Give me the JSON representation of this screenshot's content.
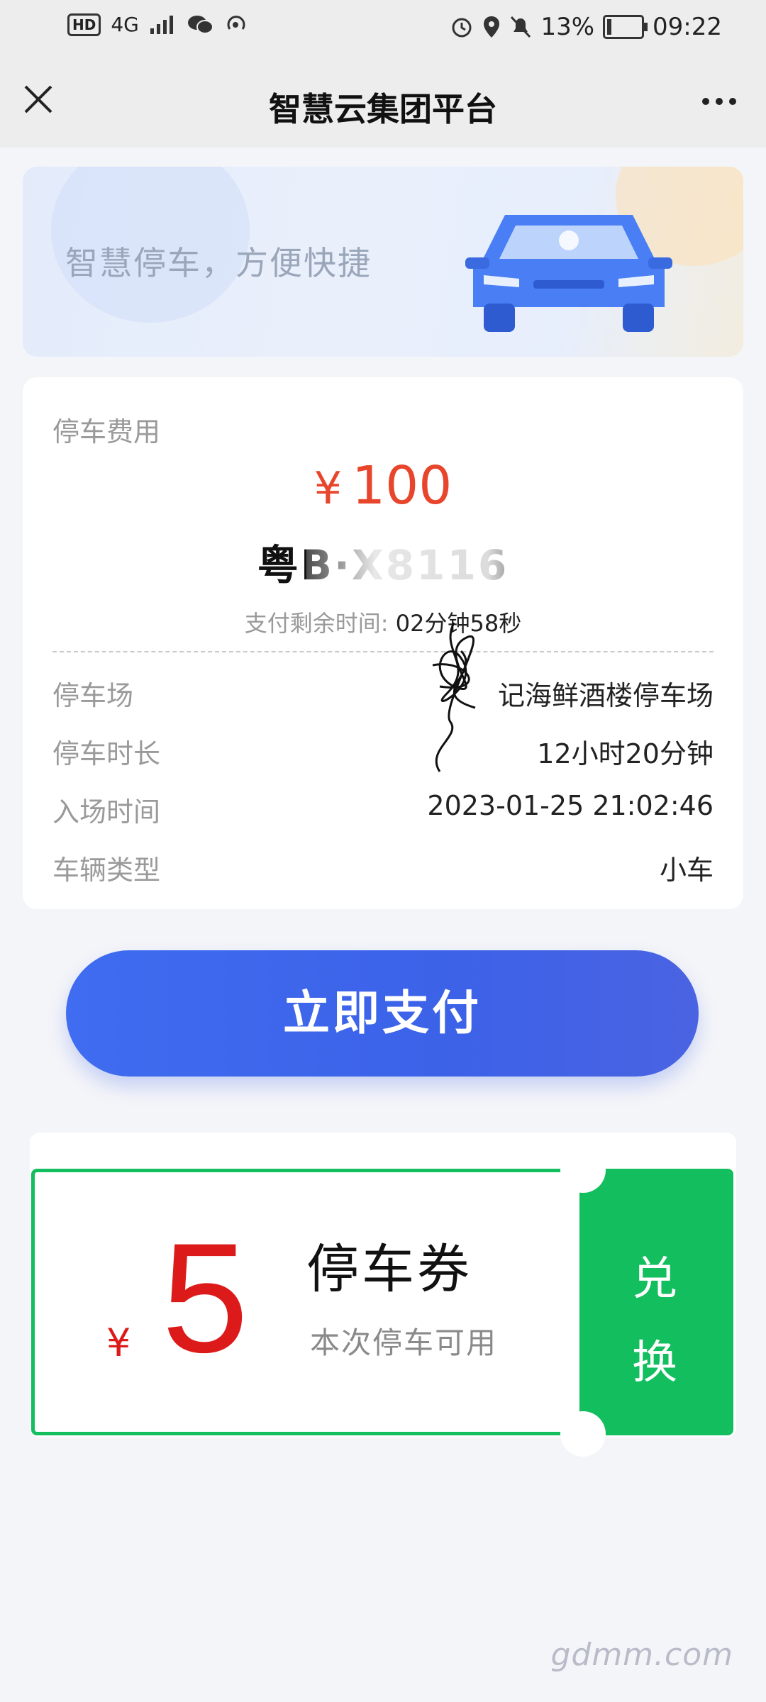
{
  "status_bar": {
    "hd": "HD",
    "network": "4G",
    "battery": "13%",
    "time": "09:22",
    "battery_level": 0.13
  },
  "nav": {
    "title": "智慧云集团平台",
    "close_icon": "close-icon",
    "more_icon": "more-icon"
  },
  "banner": {
    "slogan": "智慧停车，方便快捷",
    "image": "blue-car-illustration"
  },
  "fee": {
    "label": "停车费用",
    "currency": "¥",
    "amount": "100",
    "plate": "粤B·X8116",
    "remaining_label": "支付剩余时间:",
    "remaining_value": "02分钟58秒",
    "rows": [
      {
        "label": "停车场",
        "value": "记海鲜酒楼停车场"
      },
      {
        "label": "停车时长",
        "value": "12小时20分钟"
      },
      {
        "label": "入场时间",
        "value": "2023-01-25 21:02:46"
      },
      {
        "label": "车辆类型",
        "value": "小车"
      }
    ]
  },
  "pay_button": "立即支付",
  "coupon": {
    "currency": "¥",
    "value": "5",
    "name": "停车券",
    "desc": "本次停车可用",
    "redeem": "兑换"
  },
  "watermark": "gdmm.com",
  "colors": {
    "accent_blue": "#3c62e8",
    "price_red": "#e8462c",
    "coupon_green": "#12be5e"
  }
}
